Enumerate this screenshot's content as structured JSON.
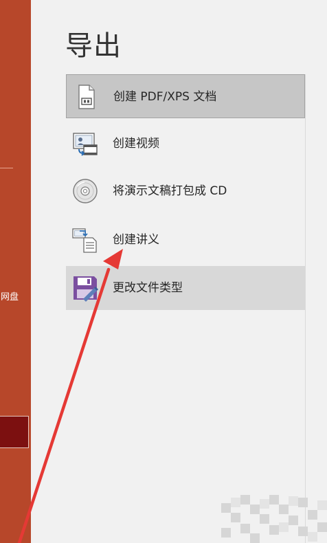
{
  "page": {
    "title": "导出"
  },
  "sidebar": {
    "partial_label": "网盘"
  },
  "options": [
    {
      "label": "创建 PDF/XPS 文档",
      "icon": "pdf-document-icon",
      "state": "selected"
    },
    {
      "label": "创建视频",
      "icon": "video-icon",
      "state": "normal"
    },
    {
      "label": "将演示文稿打包成 CD",
      "icon": "cd-icon",
      "state": "normal"
    },
    {
      "label": "创建讲义",
      "icon": "handout-icon",
      "state": "normal"
    },
    {
      "label": "更改文件类型",
      "icon": "save-file-type-icon",
      "state": "hover"
    }
  ],
  "colors": {
    "sidebar": "#b7472a",
    "sidebar_selected": "#7c1010",
    "background": "#f1f1f1",
    "selected_option": "#c6c6c6",
    "hover_option": "#d8d8d8",
    "arrow": "#e53935"
  }
}
